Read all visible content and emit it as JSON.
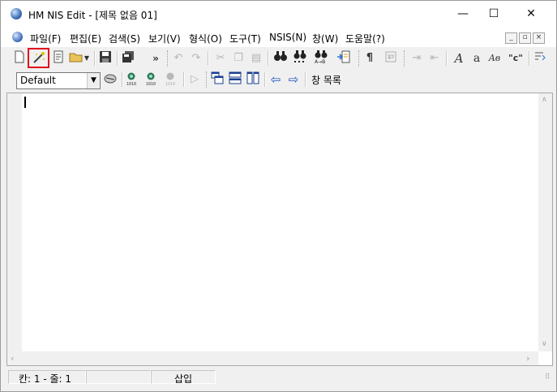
{
  "window": {
    "title": "HM NIS Edit - [제목 없음 01]",
    "min_glyph": "—",
    "max_glyph": "☐",
    "close_glyph": "✕"
  },
  "menubar": {
    "items": [
      "파일(F)",
      "편집(E)",
      "검색(S)",
      "보기(V)",
      "형식(O)",
      "도구(T)",
      "NSIS(N)",
      "창(W)",
      "도움말(?)"
    ],
    "mdi": [
      "_",
      "▫",
      "×"
    ]
  },
  "toolbar1": {
    "overflow": "»",
    "text_a_italic": "A",
    "text_a_small": "a",
    "text_ab": "Aв",
    "quote_c": "\"c\""
  },
  "toolbar2": {
    "syntax_combo_value": "Default",
    "window_list_label": "창 목록"
  },
  "editor": {
    "text": ""
  },
  "statusbar": {
    "position": "칸: 1 - 줄: 1",
    "mode": "삽입"
  },
  "colors": {
    "highlight_box": "#e0141e",
    "window_bg": "#f0f0f0"
  },
  "icons": {
    "toolbar1": [
      "new-file-icon",
      "wizard-icon",
      "template-icon",
      "open-folder-icon",
      "save-icon",
      "save-all-icon",
      "undo-icon",
      "redo-icon",
      "cut-icon",
      "copy-icon",
      "paste-icon",
      "find-icon",
      "find-next-icon",
      "replace-icon",
      "insert-file-icon",
      "paragraph-icon",
      "word-wrap-icon",
      "indent-icon",
      "outdent-icon",
      "font-icon"
    ],
    "toolbar2": [
      "syntax-icon",
      "compile-icon",
      "compile-run-icon",
      "compile-all-icon",
      "run-icon",
      "cascade-icon",
      "tile-horizontal-icon",
      "tile-vertical-icon",
      "prev-window-icon",
      "next-window-icon"
    ]
  }
}
